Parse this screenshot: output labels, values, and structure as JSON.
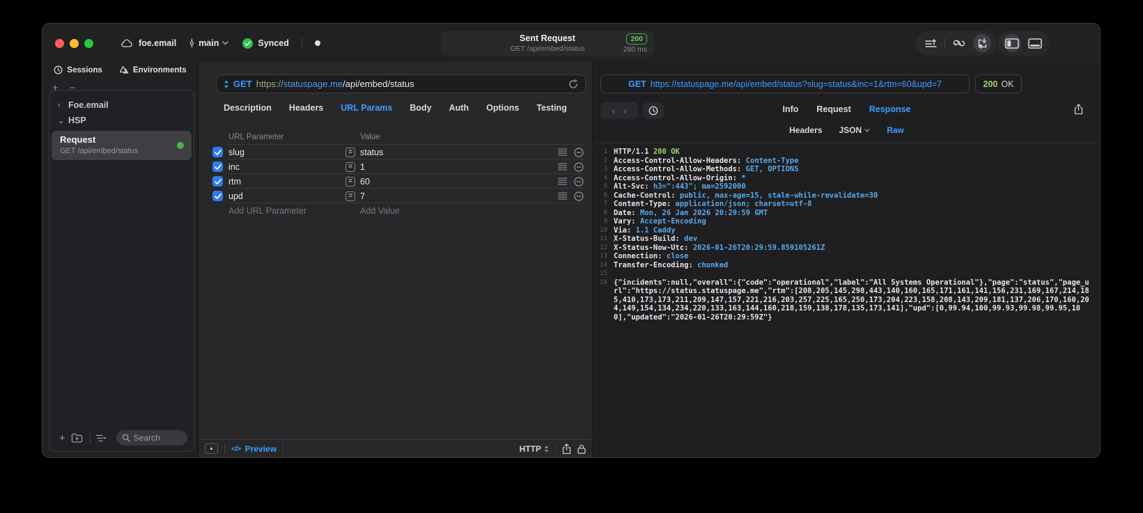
{
  "colors": {
    "accent_blue": "#3f9bff",
    "sync_green": "#2fbf4f",
    "badge_green": "#5bd06a",
    "response_green": "#9fd166",
    "header_value_blue": "#58a9e9",
    "checkbox_blue": "#2d7bf5",
    "traffic_red": "#ff5f57",
    "traffic_yellow": "#febc2e",
    "traffic_green": "#28c840"
  },
  "glyphs": {
    "plus": "+",
    "minus": "−",
    "chevron_right": "›",
    "chevron_down": "⌄",
    "back": "‹",
    "forward": "›",
    "collapse_up": "▲",
    "code": "</>",
    "equals": "="
  },
  "titlebar": {
    "project_name": "foe.email",
    "branch_name": "main",
    "sync_label": "Synced",
    "request_summary": {
      "title": "Sent Request",
      "subtitle": "GET /api/embed/status",
      "status_code": "200",
      "duration": "280 ms"
    }
  },
  "sidebar": {
    "tabs": [
      {
        "label": "Sessions"
      },
      {
        "label": "Environments"
      }
    ],
    "tree": {
      "group1": "Foe.email",
      "group2": "HSP"
    },
    "request_item": {
      "title": "Request",
      "subtitle": "GET /api/embed/status"
    },
    "search_placeholder": "Search"
  },
  "request_panel": {
    "method": "GET",
    "url": {
      "scheme": "https://",
      "host": "statuspage.me",
      "path": "/api/embed/status"
    },
    "tabs": [
      "Description",
      "Headers",
      "URL Params",
      "Body",
      "Auth",
      "Options",
      "Testing"
    ],
    "active_tab": "URL Params",
    "params": {
      "name_header": "URL Parameter",
      "value_header": "Value",
      "rows": [
        {
          "name": "slug",
          "value": "status",
          "enabled": true
        },
        {
          "name": "inc",
          "value": "1",
          "enabled": true
        },
        {
          "name": "rtm",
          "value": "60",
          "enabled": true
        },
        {
          "name": "upd",
          "value": "7",
          "enabled": true
        }
      ],
      "add_name_placeholder": "Add URL Parameter",
      "add_value_placeholder": "Add Value"
    },
    "footer": {
      "preview_label": "Preview",
      "protocol": "HTTP"
    }
  },
  "response_panel": {
    "method": "GET",
    "url": "https://statuspage.me/api/embed/status?slug=status&inc=1&rtm=60&upd=7",
    "status_code": "200",
    "status_text": "OK",
    "tabs": [
      "Info",
      "Request",
      "Response"
    ],
    "active_tab": "Response",
    "view_tabs": [
      "Headers",
      "JSON",
      "Raw"
    ],
    "active_view_tab": "Raw",
    "body_lines": [
      {
        "n": "1",
        "segs": [
          [
            "HTTP/1.1 ",
            "key"
          ],
          [
            "200 OK",
            "status"
          ]
        ]
      },
      {
        "n": "2",
        "segs": [
          [
            "Access-Control-Allow-Headers",
            "key"
          ],
          [
            ": ",
            "plain"
          ],
          [
            "Content-Type",
            "value"
          ]
        ]
      },
      {
        "n": "3",
        "segs": [
          [
            "Access-Control-Allow-Methods",
            "key"
          ],
          [
            ": ",
            "plain"
          ],
          [
            "GET, OPTIONS",
            "value"
          ]
        ]
      },
      {
        "n": "4",
        "segs": [
          [
            "Access-Control-Allow-Origin",
            "key"
          ],
          [
            ": ",
            "plain"
          ],
          [
            "*",
            "value"
          ]
        ]
      },
      {
        "n": "5",
        "segs": [
          [
            "Alt-Svc",
            "key"
          ],
          [
            ": ",
            "plain"
          ],
          [
            "h3=\":443\"; ma=2592000",
            "value"
          ]
        ]
      },
      {
        "n": "6",
        "segs": [
          [
            "Cache-Control",
            "key"
          ],
          [
            ": ",
            "plain"
          ],
          [
            "public, max-age=15, stale-while-revalidate=30",
            "value"
          ]
        ]
      },
      {
        "n": "7",
        "segs": [
          [
            "Content-Type",
            "key"
          ],
          [
            ": ",
            "plain"
          ],
          [
            "application/json; charset=utf-8",
            "value"
          ]
        ]
      },
      {
        "n": "8",
        "segs": [
          [
            "Date",
            "key"
          ],
          [
            ": ",
            "plain"
          ],
          [
            "Mon, 26 Jan 2026 20:29:59 GMT",
            "value"
          ]
        ]
      },
      {
        "n": "9",
        "segs": [
          [
            "Vary",
            "key"
          ],
          [
            ": ",
            "plain"
          ],
          [
            "Accept-Encoding",
            "value"
          ]
        ]
      },
      {
        "n": "10",
        "segs": [
          [
            "Via",
            "key"
          ],
          [
            ": ",
            "plain"
          ],
          [
            "1.1 Caddy",
            "value"
          ]
        ]
      },
      {
        "n": "11",
        "segs": [
          [
            "X-Status-Build",
            "key"
          ],
          [
            ": ",
            "plain"
          ],
          [
            "dev",
            "value"
          ]
        ]
      },
      {
        "n": "12",
        "segs": [
          [
            "X-Status-Now-Utc",
            "key"
          ],
          [
            ": ",
            "plain"
          ],
          [
            "2026-01-26T20:29:59.859105261Z",
            "value"
          ]
        ]
      },
      {
        "n": "13",
        "segs": [
          [
            "Connection",
            "key"
          ],
          [
            ": ",
            "plain"
          ],
          [
            "close",
            "value"
          ]
        ]
      },
      {
        "n": "14",
        "segs": [
          [
            "Transfer-Encoding",
            "key"
          ],
          [
            ": ",
            "plain"
          ],
          [
            "chunked",
            "value"
          ]
        ]
      },
      {
        "n": "15",
        "segs": []
      },
      {
        "n": "16",
        "segs": [
          [
            "{\"incidents\":null,\"overall\":{\"code\":\"operational\",\"label\":\"All Systems Operational\"},\"page\":\"status\",\"page_url\":\"https://status.statuspage.me\",\"rtm\":[208,205,145,298,443,140,160,165,171,161,141,156,231,169,167,214,185,410,173,173,211,209,147,157,221,216,203,257,225,165,250,173,204,223,158,208,143,209,181,137,206,170,160,204,149,154,134,234,220,133,163,144,160,218,159,138,178,135,173,141],\"upd\":[0,99.94,100,99.93,99.98,99.95,100],\"updated\":\"2026-01-26T20:29:59Z\"}",
            "plain"
          ]
        ]
      }
    ]
  }
}
